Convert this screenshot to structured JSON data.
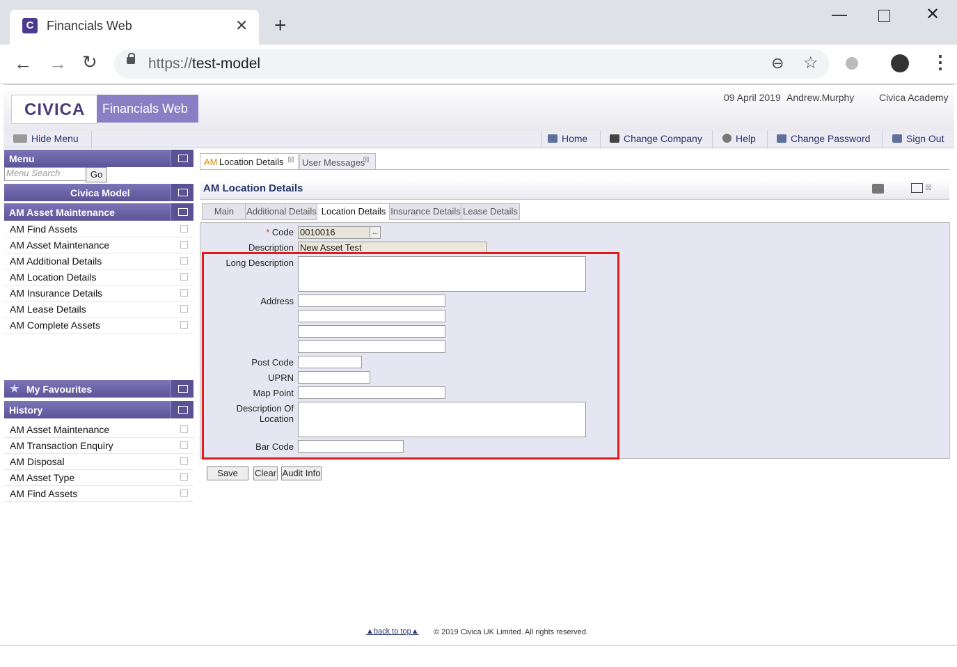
{
  "browser": {
    "tab_title": "Financials Web",
    "favicon_letter": "C",
    "url_protocol": "https://",
    "url_host": "test-model"
  },
  "header": {
    "logo": "CIVICA",
    "product": "Financials Web",
    "date": "09 April 2019",
    "user": "Andrew.Murphy",
    "company": "Civica Academy"
  },
  "nav": {
    "hide_menu": "Hide Menu",
    "home": "Home",
    "change_company": "Change Company",
    "help": "Help",
    "change_password": "Change Password",
    "sign_out": "Sign Out"
  },
  "sidebar": {
    "menu_title": "Menu",
    "search_placeholder": "Menu Search",
    "go_label": "Go",
    "model_title": "Civica Model",
    "asset_title": "AM Asset Maintenance",
    "asset_items": [
      "AM Find Assets",
      "AM Asset Maintenance",
      "AM Additional Details",
      "AM Location Details",
      "AM Insurance Details",
      "AM Lease Details",
      "AM Complete Assets"
    ],
    "favourites_title": "My Favourites",
    "history_title": "History",
    "history_items": [
      "AM Asset Maintenance",
      "AM Transaction Enquiry",
      "AM Disposal",
      "AM Asset Type",
      "AM Find Assets"
    ]
  },
  "page_tabs": {
    "active_prefix": "AM",
    "active_rest": "Location Details",
    "other": "User Messages"
  },
  "page": {
    "title": "AM Location Details",
    "subtabs": [
      "Main",
      "Additional Details",
      "Location Details",
      "Insurance Details",
      "Lease Details"
    ]
  },
  "form": {
    "code_label": "Code",
    "code_value": "0010016",
    "code_lookup": "...",
    "description_label": "Description",
    "description_value": "New Asset Test",
    "long_description_label": "Long Description",
    "address_label": "Address",
    "post_code_label": "Post Code",
    "uprn_label": "UPRN",
    "map_point_label": "Map Point",
    "description_of_location_label": "Description Of Location",
    "bar_code_label": "Bar Code"
  },
  "buttons": {
    "save": "Save",
    "clear": "Clear",
    "audit": "Audit Info"
  },
  "footer": {
    "back_to_top": "back to top",
    "copyright": "© 2019 Civica UK Limited. All rights reserved."
  },
  "colors": {
    "accent": "#5c5497",
    "highlight_box": "#e01b1b",
    "link": "#27346c"
  }
}
